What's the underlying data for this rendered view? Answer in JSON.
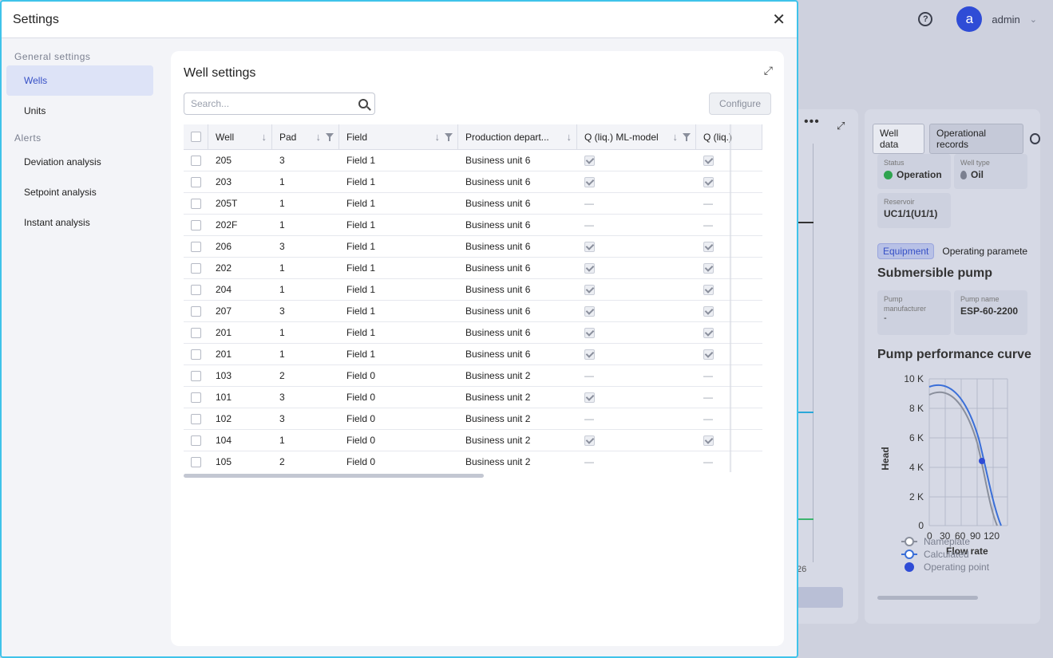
{
  "background": {
    "user": {
      "avatar_letter": "a",
      "name": "admin"
    },
    "chart_tick": "26",
    "right_card": {
      "tabs": [
        "Well data",
        "Operational records"
      ],
      "status_label": "Status",
      "status_value": "Operation",
      "well_type_label": "Well type",
      "well_type_value": "Oil",
      "reservoir_label": "Reservoir",
      "reservoir_value": "UC1/1(U1/1)",
      "subtabs": [
        "Equipment",
        "Operating paramete"
      ],
      "section_title": "Submersible pump",
      "manufacturer_label": "Pump manufacturer",
      "manufacturer_value": "-",
      "pump_name_label": "Pump name",
      "pump_name_value": "ESP-60-2200",
      "curve_title": "Pump performance curve",
      "curve_ylabel": "Head",
      "curve_xlabel": "Flow rate",
      "curve_yticks": [
        "10 K",
        "8 K",
        "6 K",
        "4 K",
        "2 K",
        "0"
      ],
      "curve_xticks": [
        "0",
        "30",
        "60",
        "90",
        "120"
      ],
      "legend": [
        "Nameplate",
        "Calculated",
        "Operating point"
      ],
      "colors": {
        "nameplate": "#8a8f9c",
        "calculated": "#3a6fd8",
        "operating_point": "#2f4cd6"
      }
    }
  },
  "modal": {
    "title": "Settings",
    "sidebar": {
      "sections": [
        {
          "label": "General settings",
          "items": [
            "Wells",
            "Units"
          ]
        },
        {
          "label": "Alerts",
          "items": [
            "Deviation analysis",
            "Setpoint analysis",
            "Instant analysis"
          ]
        }
      ],
      "active": "Wells"
    },
    "card_title": "Well settings",
    "search_placeholder": "Search...",
    "configure_label": "Configure",
    "columns": [
      "Well",
      "Pad",
      "Field",
      "Production depart...",
      "Q (liq.) ML-model",
      "Q (liq.)"
    ],
    "rows": [
      {
        "well": "205",
        "pad": "3",
        "field": "Field 1",
        "dept": "Business unit 6",
        "ml": true,
        "q": true
      },
      {
        "well": "203",
        "pad": "1",
        "field": "Field 1",
        "dept": "Business unit 6",
        "ml": true,
        "q": true
      },
      {
        "well": "205T",
        "pad": "1",
        "field": "Field 1",
        "dept": "Business unit 6",
        "ml": false,
        "q": false
      },
      {
        "well": "202F",
        "pad": "1",
        "field": "Field 1",
        "dept": "Business unit 6",
        "ml": false,
        "q": false
      },
      {
        "well": "206",
        "pad": "3",
        "field": "Field 1",
        "dept": "Business unit 6",
        "ml": true,
        "q": true
      },
      {
        "well": "202",
        "pad": "1",
        "field": "Field 1",
        "dept": "Business unit 6",
        "ml": true,
        "q": true
      },
      {
        "well": "204",
        "pad": "1",
        "field": "Field 1",
        "dept": "Business unit 6",
        "ml": true,
        "q": true
      },
      {
        "well": "207",
        "pad": "3",
        "field": "Field 1",
        "dept": "Business unit 6",
        "ml": true,
        "q": true
      },
      {
        "well": "201",
        "pad": "1",
        "field": "Field 1",
        "dept": "Business unit 6",
        "ml": true,
        "q": true
      },
      {
        "well": "201",
        "pad": "1",
        "field": "Field 1",
        "dept": "Business unit 6",
        "ml": true,
        "q": true
      },
      {
        "well": "103",
        "pad": "2",
        "field": "Field 0",
        "dept": "Business unit 2",
        "ml": false,
        "q": false
      },
      {
        "well": "101",
        "pad": "3",
        "field": "Field 0",
        "dept": "Business unit 2",
        "ml": true,
        "q": false
      },
      {
        "well": "102",
        "pad": "3",
        "field": "Field 0",
        "dept": "Business unit 2",
        "ml": false,
        "q": false
      },
      {
        "well": "104",
        "pad": "1",
        "field": "Field 0",
        "dept": "Business unit 2",
        "ml": true,
        "q": true
      },
      {
        "well": "105",
        "pad": "2",
        "field": "Field 0",
        "dept": "Business unit 2",
        "ml": false,
        "q": false
      }
    ],
    "colors": {
      "accent": "#3650c6",
      "modal_border": "#3fc3ea"
    }
  }
}
